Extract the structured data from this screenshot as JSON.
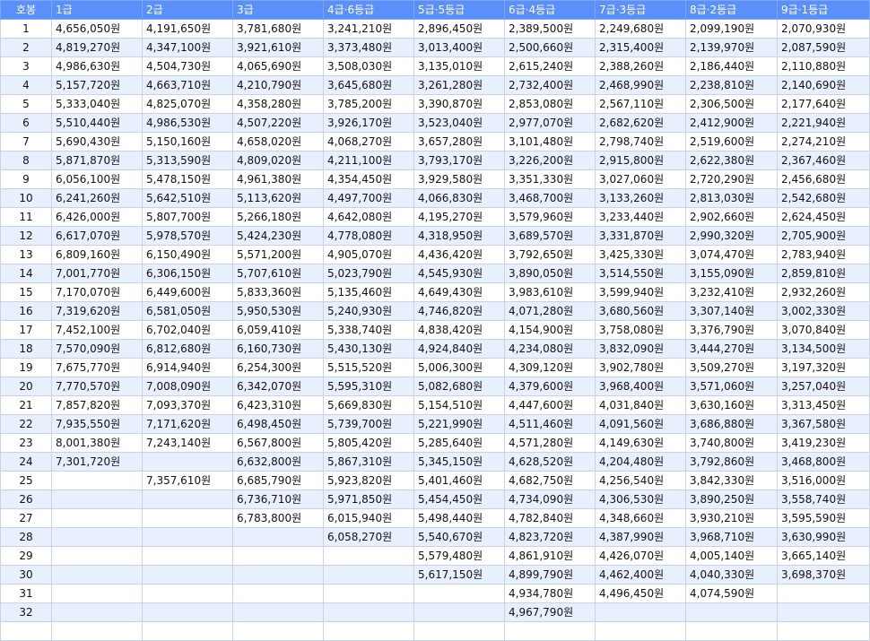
{
  "table": {
    "headers": [
      "호봉",
      "1급",
      "2급",
      "3급",
      "4급·6등급",
      "5급·5등급",
      "6급·4등급",
      "7급·3등급",
      "8급·2등급",
      "9급·1등급"
    ],
    "rows": [
      [
        "1",
        "4,656,050원",
        "4,191,650원",
        "3,781,680원",
        "3,241,210원",
        "2,896,450원",
        "2,389,500원",
        "2,249,680원",
        "2,099,190원",
        "2,070,930원"
      ],
      [
        "2",
        "4,819,270원",
        "4,347,100원",
        "3,921,610원",
        "3,373,480원",
        "3,013,400원",
        "2,500,660원",
        "2,315,400원",
        "2,139,970원",
        "2,087,590원"
      ],
      [
        "3",
        "4,986,630원",
        "4,504,730원",
        "4,065,690원",
        "3,508,030원",
        "3,135,010원",
        "2,615,240원",
        "2,388,260원",
        "2,186,440원",
        "2,110,880원"
      ],
      [
        "4",
        "5,157,720원",
        "4,663,710원",
        "4,210,790원",
        "3,645,680원",
        "3,261,280원",
        "2,732,400원",
        "2,468,990원",
        "2,238,810원",
        "2,140,690원"
      ],
      [
        "5",
        "5,333,040원",
        "4,825,070원",
        "4,358,280원",
        "3,785,200원",
        "3,390,870원",
        "2,853,080원",
        "2,567,110원",
        "2,306,500원",
        "2,177,640원"
      ],
      [
        "6",
        "5,510,440원",
        "4,986,530원",
        "4,507,220원",
        "3,926,170원",
        "3,523,040원",
        "2,977,070원",
        "2,682,620원",
        "2,412,900원",
        "2,221,940원"
      ],
      [
        "7",
        "5,690,430원",
        "5,150,160원",
        "4,658,020원",
        "4,068,270원",
        "3,657,280원",
        "3,101,480원",
        "2,798,740원",
        "2,519,600원",
        "2,274,210원"
      ],
      [
        "8",
        "5,871,870원",
        "5,313,590원",
        "4,809,020원",
        "4,211,100원",
        "3,793,170원",
        "3,226,200원",
        "2,915,800원",
        "2,622,380원",
        "2,367,460원"
      ],
      [
        "9",
        "6,056,100원",
        "5,478,150원",
        "4,961,380원",
        "4,354,450원",
        "3,929,580원",
        "3,351,330원",
        "3,027,060원",
        "2,720,290원",
        "2,456,680원"
      ],
      [
        "10",
        "6,241,260원",
        "5,642,510원",
        "5,113,620원",
        "4,497,700원",
        "4,066,830원",
        "3,468,700원",
        "3,133,260원",
        "2,813,030원",
        "2,542,680원"
      ],
      [
        "11",
        "6,426,000원",
        "5,807,700원",
        "5,266,180원",
        "4,642,080원",
        "4,195,270원",
        "3,579,960원",
        "3,233,440원",
        "2,902,660원",
        "2,624,450원"
      ],
      [
        "12",
        "6,617,070원",
        "5,978,570원",
        "5,424,230원",
        "4,778,080원",
        "4,318,950원",
        "3,689,570원",
        "3,331,870원",
        "2,990,320원",
        "2,705,900원"
      ],
      [
        "13",
        "6,809,160원",
        "6,150,490원",
        "5,571,200원",
        "4,905,070원",
        "4,436,420원",
        "3,792,650원",
        "3,425,330원",
        "3,074,470원",
        "2,783,940원"
      ],
      [
        "14",
        "7,001,770원",
        "6,306,150원",
        "5,707,610원",
        "5,023,790원",
        "4,545,930원",
        "3,890,050원",
        "3,514,550원",
        "3,155,090원",
        "2,859,810원"
      ],
      [
        "15",
        "7,170,070원",
        "6,449,600원",
        "5,833,360원",
        "5,135,460원",
        "4,649,430원",
        "3,983,610원",
        "3,599,940원",
        "3,232,410원",
        "2,932,260원"
      ],
      [
        "16",
        "7,319,620원",
        "6,581,050원",
        "5,950,530원",
        "5,240,930원",
        "4,746,820원",
        "4,071,280원",
        "3,680,560원",
        "3,307,140원",
        "3,002,330원"
      ],
      [
        "17",
        "7,452,100원",
        "6,702,040원",
        "6,059,410원",
        "5,338,740원",
        "4,838,420원",
        "4,154,900원",
        "3,758,080원",
        "3,376,790원",
        "3,070,840원"
      ],
      [
        "18",
        "7,570,090원",
        "6,812,680원",
        "6,160,730원",
        "5,430,130원",
        "4,924,840원",
        "4,234,080원",
        "3,832,090원",
        "3,444,270원",
        "3,134,500원"
      ],
      [
        "19",
        "7,675,770원",
        "6,914,940원",
        "6,254,300원",
        "5,515,520원",
        "5,006,300원",
        "4,309,120원",
        "3,902,780원",
        "3,509,270원",
        "3,197,320원"
      ],
      [
        "20",
        "7,770,570원",
        "7,008,090원",
        "6,342,070원",
        "5,595,310원",
        "5,082,680원",
        "4,379,600원",
        "3,968,400원",
        "3,571,060원",
        "3,257,040원"
      ],
      [
        "21",
        "7,857,820원",
        "7,093,370원",
        "6,423,310원",
        "5,669,830원",
        "5,154,510원",
        "4,447,600원",
        "4,031,840원",
        "3,630,160원",
        "3,313,450원"
      ],
      [
        "22",
        "7,935,550원",
        "7,171,620원",
        "6,498,450원",
        "5,739,700원",
        "5,221,990원",
        "4,511,460원",
        "4,091,560원",
        "3,686,880원",
        "3,367,580원"
      ],
      [
        "23",
        "8,001,380원",
        "7,243,140원",
        "6,567,800원",
        "5,805,420원",
        "5,285,640원",
        "4,571,280원",
        "4,149,630원",
        "3,740,800원",
        "3,419,230원"
      ],
      [
        "24",
        "7,301,720원",
        "",
        "6,632,800원",
        "5,867,310원",
        "5,345,150원",
        "4,628,520원",
        "4,204,480원",
        "3,792,860원",
        "3,468,800원"
      ],
      [
        "25",
        "",
        "7,357,610원",
        "6,685,790원",
        "5,923,820원",
        "5,401,460원",
        "4,682,750원",
        "4,256,540원",
        "3,842,330원",
        "3,516,000원"
      ],
      [
        "26",
        "",
        "",
        "6,736,710원",
        "5,971,850원",
        "5,454,450원",
        "4,734,090원",
        "4,306,530원",
        "3,890,250원",
        "3,558,740원"
      ],
      [
        "27",
        "",
        "",
        "6,783,800원",
        "6,015,940원",
        "5,498,440원",
        "4,782,840원",
        "4,348,660원",
        "3,930,210원",
        "3,595,590원"
      ],
      [
        "28",
        "",
        "",
        "",
        "6,058,270원",
        "5,540,670원",
        "4,823,720원",
        "4,387,990원",
        "3,968,710원",
        "3,630,990원"
      ],
      [
        "29",
        "",
        "",
        "",
        "",
        "5,579,480원",
        "4,861,910원",
        "4,426,070원",
        "4,005,140원",
        "3,665,140원"
      ],
      [
        "30",
        "",
        "",
        "",
        "",
        "5,617,150원",
        "4,899,790원",
        "4,462,400원",
        "4,040,330원",
        "3,698,370원"
      ],
      [
        "31",
        "",
        "",
        "",
        "",
        "",
        "4,934,780원",
        "4,496,450원",
        "4,074,590원",
        ""
      ],
      [
        "32",
        "",
        "",
        "",
        "",
        "",
        "4,967,790원",
        "",
        "",
        ""
      ],
      [
        "",
        "",
        "",
        "",
        "",
        "",
        "",
        "",
        "",
        ""
      ]
    ]
  },
  "colors": {
    "header_bg": "#5b8ff9",
    "header_text": "#ffffff",
    "stripe": "#e8effd",
    "grid": "#c8d4e6"
  }
}
